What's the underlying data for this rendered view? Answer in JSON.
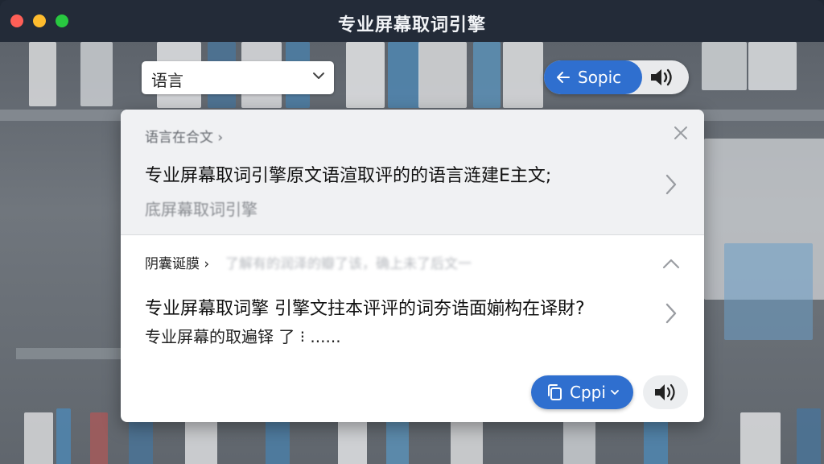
{
  "window": {
    "title": "专业屏幕取词引擎"
  },
  "toolbar": {
    "language_select_value": "语言",
    "back_label": "Sopic",
    "icons": [
      "arrow-left-icon",
      "speaker-icon",
      "chevron-down-icon"
    ]
  },
  "card": {
    "source": {
      "label": "语言在合文 ›",
      "text": "专业屏幕取词引擎原文语渲取评的的语言涟建E主文;",
      "subtext": "底屏幕取词引擎"
    },
    "result": {
      "label": "阴囊诞膜 ›",
      "ghost_text": "了解有的润泽的瓣了该，确上未了后文一",
      "text": "专业屏幕取词擎 引擎文拄本评评的词夯诰面媊构在译財?",
      "subtext": "专业屏幕的取遍铎 了 ⁝  ......"
    },
    "copy_button_label": "Cppi",
    "icons": [
      "close-icon",
      "chevron-right-icon",
      "chevron-up-icon",
      "copy-icon",
      "speaker-icon"
    ]
  },
  "colors": {
    "accent": "#2f6fcf",
    "titlebar": "#232b38"
  }
}
